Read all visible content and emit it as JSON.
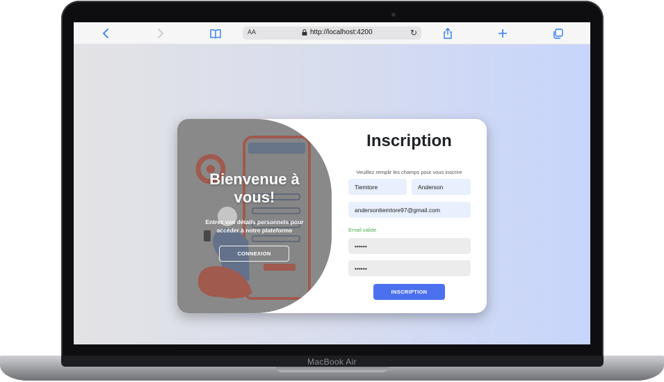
{
  "device": {
    "label": "MacBook Air"
  },
  "browser": {
    "text_size_label": "AA",
    "url": "http://localhost:4200",
    "icons": [
      "back-icon",
      "forward-icon",
      "bookmarks-icon",
      "lock-icon",
      "reload-icon",
      "share-icon",
      "new-tab-icon",
      "tabs-icon"
    ]
  },
  "welcome_panel": {
    "title": "Bienvenue à vous!",
    "subtitle": "Entrez vos détails personnels pour accéder à notre plateforme",
    "login_button": "CONNEXION"
  },
  "signup_form": {
    "title": "Inscription",
    "instructions": "Veuillez remplir les champs pour vous inscrire",
    "first_name": "Tiemtore",
    "last_name": "Anderson",
    "email": "andersontiemtore97@gmail.com",
    "email_status": "Email valide",
    "password_mask": "••••••",
    "confirm_password_mask": "••••••",
    "submit_button": "INSCRIPTION"
  },
  "colors": {
    "primary_button": "#4b71ee",
    "valid_text": "#4caf50",
    "input_blue": "#e8effd",
    "input_grey": "#ececec",
    "panel_grey": "#8f8f8f",
    "link_blue": "#2f7df6"
  }
}
